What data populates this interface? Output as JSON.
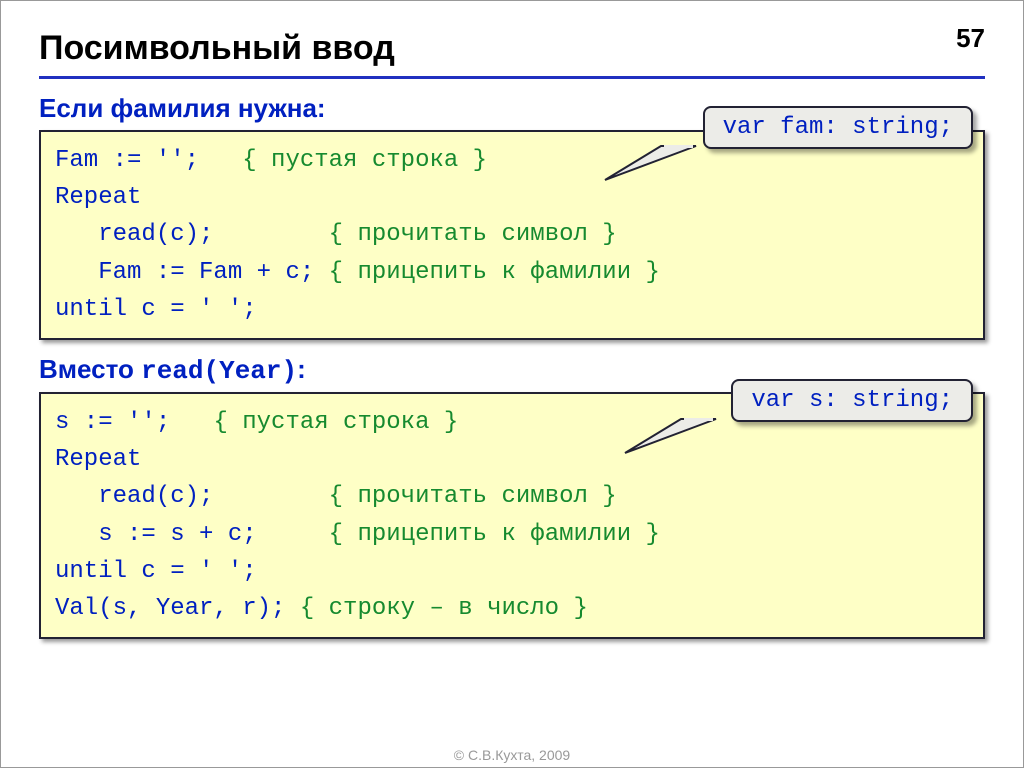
{
  "page_number": "57",
  "title": "Посимвольный ввод",
  "section1": {
    "heading": "Если фамилия нужна:",
    "callout": "var fam: string;",
    "code": {
      "l1a": "Fam := '';   ",
      "l1c": "{ пустая строка }",
      "l2": "Repeat",
      "l3a": "   read(c);        ",
      "l3c": "{ прочитать символ }",
      "l4a": "   Fam := Fam + c; ",
      "l4c": "{ прицепить к фамилии }",
      "l5": "until c = ' ';"
    }
  },
  "section2": {
    "heading_pre": "Вместо ",
    "heading_mono": "read(Year)",
    "heading_post": ":",
    "callout": "var s: string;",
    "code": {
      "l1a": "s := '';   ",
      "l1c": "{ пустая строка }",
      "l2": "Repeat",
      "l3a": "   read(c);        ",
      "l3c": "{ прочитать символ }",
      "l4a": "   s := s + c;     ",
      "l4c": "{ прицепить к фамилии }",
      "l5": "until c = ' ';",
      "l6a": "Val(s, Year, r); ",
      "l6c": "{ строку – в число }"
    }
  },
  "footer": "© С.В.Кухта, 2009"
}
